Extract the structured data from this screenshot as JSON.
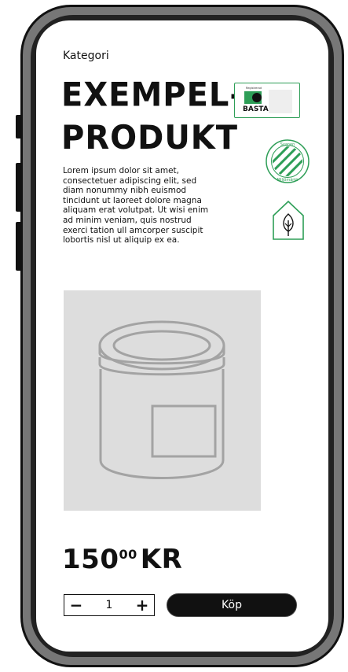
{
  "product": {
    "category": "Kategori",
    "title_line1": "EXEMPEL-",
    "title_line2": "PRODUKT",
    "description": "Lorem ipsum dolor sit amet, consectetuer adipiscing elit, sed diam nonummy nibh euismod tincidunt ut laoreet dolore magna aliquam erat volutpat. Ut wisi enim ad minim veniam, quis nostrud exerci tation ull amcorper suscipit lobortis nisl ut aliquip ex ea.",
    "price_main": "150",
    "price_decimals": "00",
    "currency": "KR"
  },
  "badges": {
    "basta_label": "BASTA",
    "basta_small": "Registrerad",
    "swan_top": "Svanen",
    "swan_bottom": "Miljömärkt"
  },
  "purchase": {
    "minus": "−",
    "quantity": "1",
    "plus": "+",
    "buy_label": "Köp"
  },
  "colors": {
    "accent_green": "#2e9e57",
    "dark": "#111111",
    "placeholder_bg": "#dddddd"
  }
}
